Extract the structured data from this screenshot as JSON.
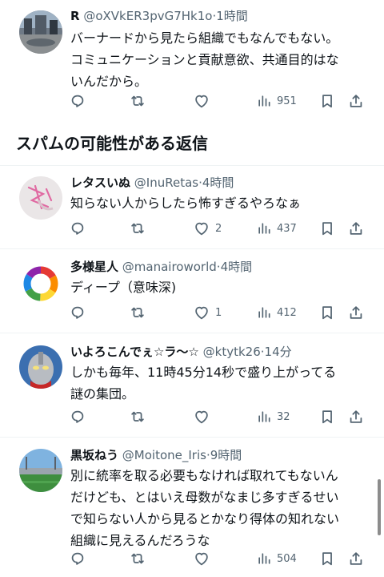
{
  "top_tweet": {
    "name": "R",
    "handle": "@oXVkER3pvG7Hk1o",
    "time": "1時間",
    "lines": [
      "バーナードから見たら組織でもなんでもない。",
      "コミュニケーションと貢献意欲、共通目的はな",
      "いんだから。"
    ],
    "views": "951"
  },
  "spam_section": {
    "title": "スパムの可能性がある返信"
  },
  "replies": [
    {
      "name": "レタスいぬ",
      "handle": "@InuRetas",
      "time": "4時間",
      "lines": [
        "知らない人からしたら怖すぎるやろなぁ"
      ],
      "likes": "2",
      "views": "437"
    },
    {
      "name": "多様星人",
      "handle": "@manairoworld",
      "time": "4時間",
      "lines": [
        "ディープ（意味深)"
      ],
      "likes": "1",
      "views": "412"
    },
    {
      "name": "いよろこんでぇ☆ラ〜☆",
      "handle": "@ktytk26",
      "time": "14分",
      "lines": [
        "しかも毎年、11時45分14秒で盛り上がってる",
        "謎の集団。"
      ],
      "likes": "",
      "views": "32"
    },
    {
      "name": "黒坂ねう",
      "handle": "@Moitone_Iris",
      "time": "9時間",
      "lines": [
        "別に統率を取る必要もなければ取れてもないん",
        "だけども、とはいえ母数がなまじ多すぎるせい",
        "で知らない人から見るとかなり得体の知れない",
        "組織に見えるんだろうな"
      ],
      "likes": "",
      "views": "504"
    }
  ],
  "icons": [
    "reply-icon",
    "retweet-icon",
    "like-icon",
    "views-icon",
    "bookmark-icon",
    "share-icon"
  ],
  "colors": {
    "text": "#0f1419",
    "secondary": "#536471",
    "divider": "#eff3f4"
  }
}
